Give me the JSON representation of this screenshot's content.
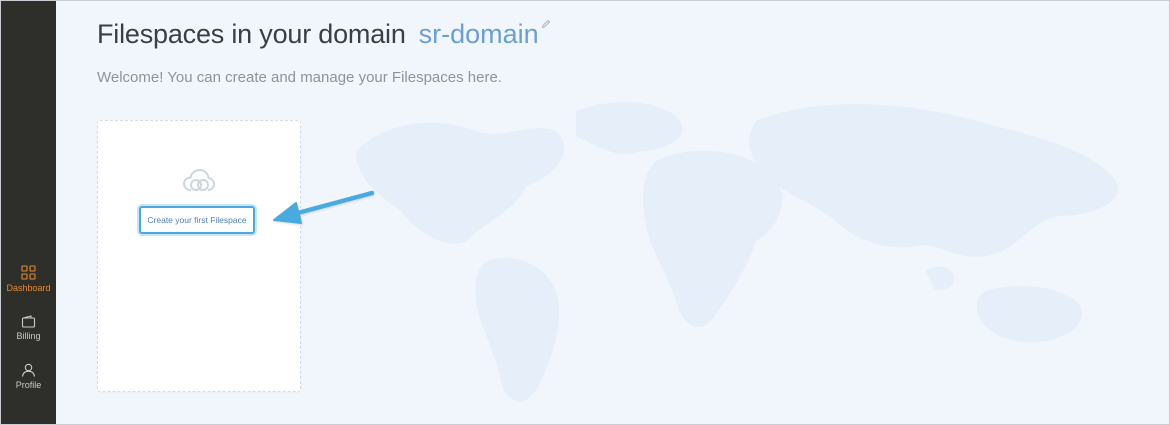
{
  "sidebar": {
    "items": [
      {
        "label": "Dashboard",
        "icon": "dashboard-grid-icon",
        "active": true
      },
      {
        "label": "Billing",
        "icon": "wallet-icon",
        "active": false
      },
      {
        "label": "Profile",
        "icon": "user-icon",
        "active": false
      }
    ]
  },
  "header": {
    "title": "Filespaces in your domain",
    "domain": "sr-domain",
    "subtitle": "Welcome! You can create and manage your Filespaces here."
  },
  "card": {
    "icon": "cloud-link-icon",
    "button_label": "Create your first Filespace"
  },
  "colors": {
    "sidebar_bg": "#2e2f2b",
    "accent_active": "#e8892c",
    "domain_blue": "#6b9fd3",
    "callout_arrow": "#4aaae0",
    "page_bg": "#f1f6fd"
  }
}
